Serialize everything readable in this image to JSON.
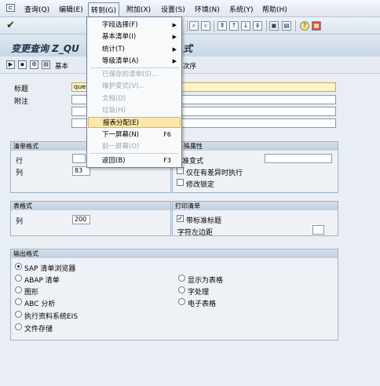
{
  "menubar": {
    "items": [
      "查询(Q)",
      "编辑(E)",
      "转到(G)",
      "附加(X)",
      "设置(S)",
      "环境(N)",
      "系统(Y)",
      "帮助(H)"
    ]
  },
  "title": "变更查询 Z_QU",
  "title_suffix": "式",
  "app_toolbar": {
    "basic_label": "基本",
    "order_label": "次序"
  },
  "dropdown": {
    "items": [
      {
        "label": "字段选择(F)",
        "arrow": "▶",
        "disabled": false
      },
      {
        "label": "基本清单(I)",
        "arrow": "▶",
        "disabled": false
      },
      {
        "label": "统计(T)",
        "arrow": "▶",
        "disabled": false
      },
      {
        "label": "等级清单(A)",
        "arrow": "▶",
        "disabled": false
      },
      {
        "label": "已保存的清单(S)...",
        "disabled": true
      },
      {
        "label": "维护变式(V)...",
        "disabled": true
      },
      {
        "label": "文档(D)",
        "disabled": true
      },
      {
        "label": "垃圾(H)",
        "disabled": true
      },
      {
        "label": "报表分配(E)",
        "disabled": false
      },
      {
        "label": "下一屏幕(N)",
        "key": "F6",
        "disabled": false
      },
      {
        "label": "前一屏幕(O)",
        "disabled": true
      },
      {
        "label": "返回(B)",
        "key": "F3",
        "disabled": false
      }
    ]
  },
  "header": {
    "title_label": "标题",
    "title_value": "quer",
    "note_label": "附注"
  },
  "list_format": {
    "group": "清单格式",
    "row_label": "行",
    "col_label": "列",
    "col_value": "83"
  },
  "special": {
    "group": "殊属性",
    "variant_label": "准变式",
    "diff_label": "仅在有差异时执行",
    "lock_label": "修改锁定"
  },
  "table_format": {
    "group": "表格式",
    "col_label": "列",
    "col_value": "200"
  },
  "print": {
    "group": "打印清单",
    "std_title_label": "带标准标题",
    "left_margin_label": "字符左边距"
  },
  "output": {
    "group": "输出格式",
    "left": [
      "SAP 清单浏览器",
      "ABAP 清单",
      "图形",
      "ABC 分析",
      "执行资料系统EIS",
      "文件存储"
    ],
    "right": [
      "显示为表格",
      "字处理",
      "电子表格"
    ]
  }
}
